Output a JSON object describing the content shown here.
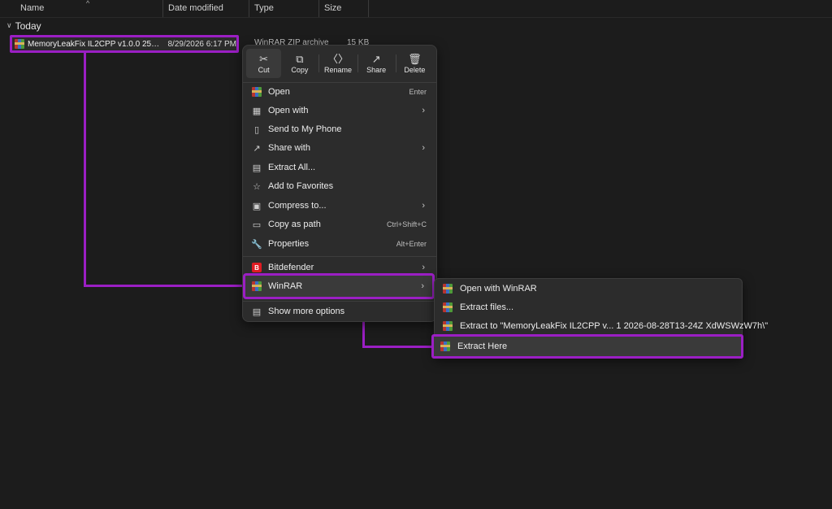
{
  "columns": {
    "name": "Name",
    "date_modified": "Date modified",
    "type": "Type",
    "size": "Size"
  },
  "group_label": "Today",
  "file": {
    "name": "MemoryLeakFix IL2CPP v1.0.0 2511 1 202...",
    "date": "8/29/2026 6:17 PM",
    "type": "WinRAR ZIP archive",
    "size": "15 KB",
    "icon": "winrar-archive-icon"
  },
  "context_menu": {
    "quick_actions": [
      {
        "label": "Cut",
        "icon": "scissors-icon"
      },
      {
        "label": "Copy",
        "icon": "copy-icon"
      },
      {
        "label": "Rename",
        "icon": "rename-icon"
      },
      {
        "label": "Share",
        "icon": "share-icon"
      },
      {
        "label": "Delete",
        "icon": "trash-icon"
      }
    ],
    "items": [
      {
        "label": "Open",
        "shortcut": "Enter"
      },
      {
        "label": "Open with"
      },
      {
        "label": "Send to My Phone"
      },
      {
        "label": "Share with"
      },
      {
        "label": "Extract All..."
      },
      {
        "label": "Add to Favorites"
      },
      {
        "label": "Compress to..."
      },
      {
        "label": "Copy as path",
        "shortcut": "Ctrl+Shift+C"
      },
      {
        "label": "Properties",
        "shortcut": "Alt+Enter"
      },
      {
        "label": "Bitdefender"
      },
      {
        "label": "WinRAR"
      },
      {
        "label": "Show more options"
      }
    ]
  },
  "winrar_submenu": {
    "items": [
      {
        "label": "Open with WinRAR"
      },
      {
        "label": "Extract files..."
      },
      {
        "label": "Extract to \"MemoryLeakFix IL2CPP v... 1 2026-08-28T13-24Z XdWSWzW7h\\\""
      },
      {
        "label": "Extract Here"
      }
    ]
  },
  "colors": {
    "highlight_outline": "#9b1fc4",
    "menu_bg": "#2c2c2c",
    "window_bg": "#1c1c1c"
  }
}
